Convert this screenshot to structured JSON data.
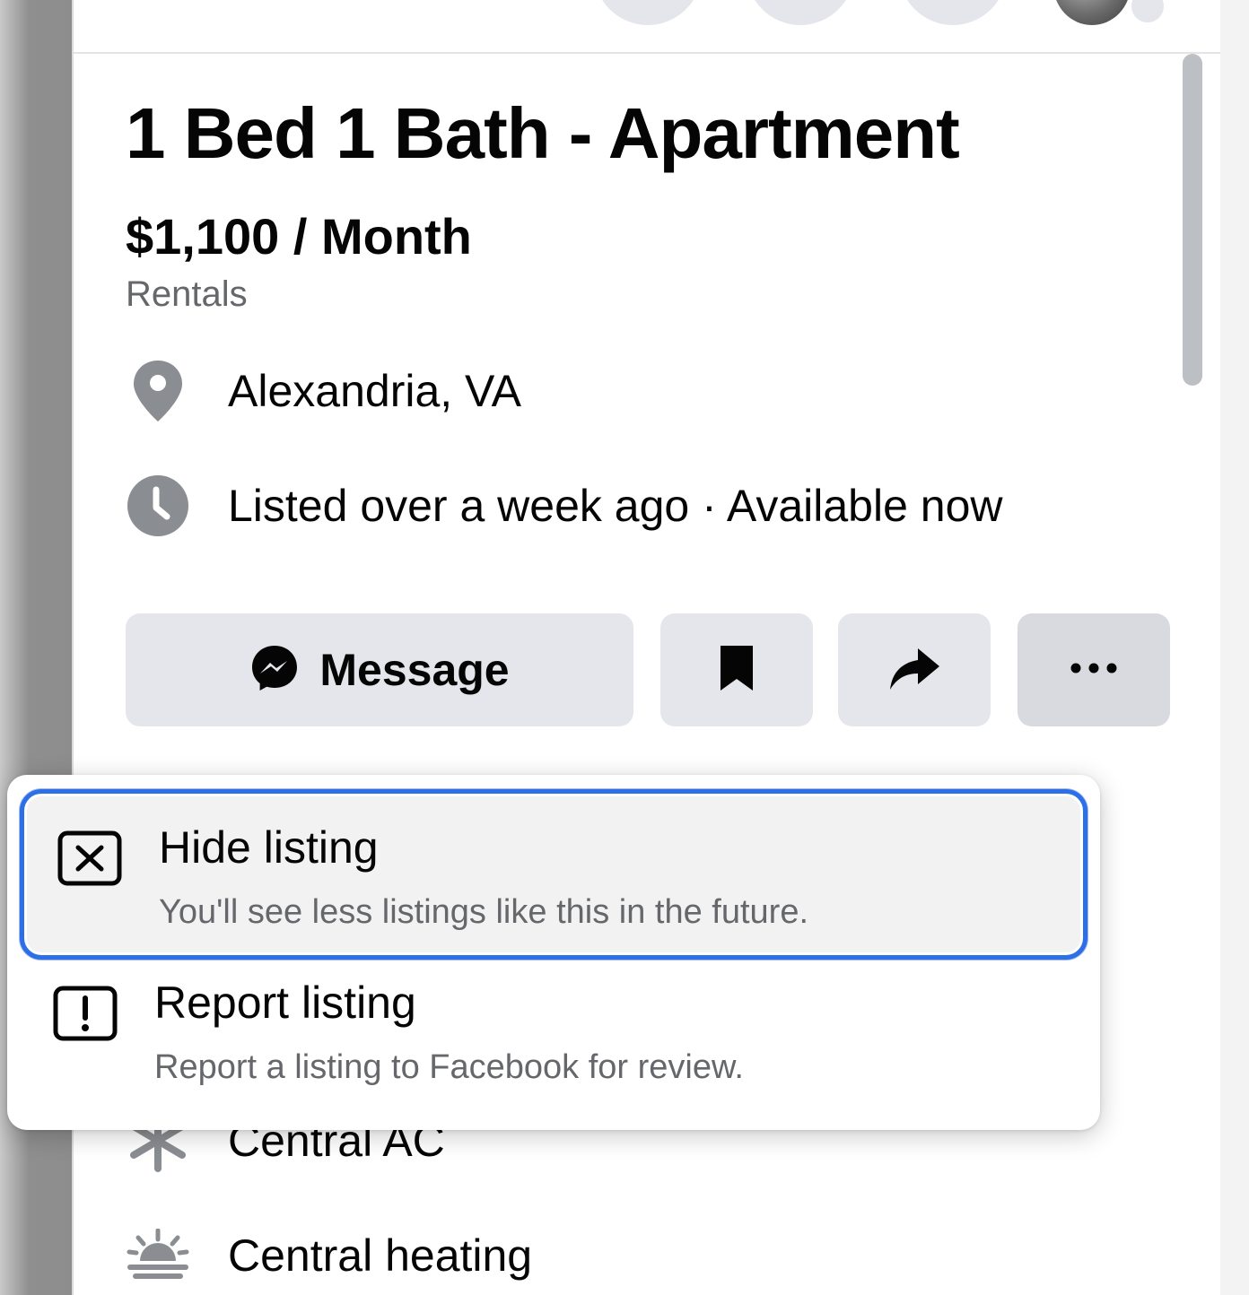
{
  "listing": {
    "title": "1 Bed 1 Bath - Apartment",
    "price": "$1,100 / Month",
    "category": "Rentals",
    "location": "Alexandria, VA",
    "listed": "Listed over a week ago · Available now"
  },
  "actions": {
    "message_label": "Message"
  },
  "menu": {
    "hide": {
      "title": "Hide listing",
      "subtitle": "You'll see less listings like this in the future."
    },
    "report": {
      "title": "Report listing",
      "subtitle": "Report a listing to Facebook for review."
    }
  },
  "amenities": [
    {
      "label": "Central AC",
      "icon": "snowflake-icon"
    },
    {
      "label": "Central heating",
      "icon": "heating-icon"
    }
  ],
  "colors": {
    "focus_ring": "#2d6fe6",
    "button_bg": "#e4e6eb",
    "secondary_text": "#65676b"
  }
}
